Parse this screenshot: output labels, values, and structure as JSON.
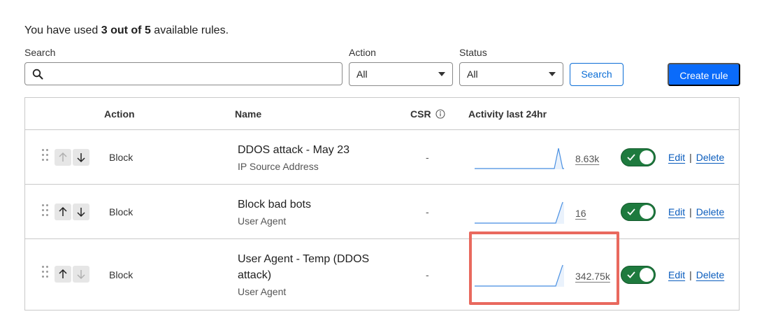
{
  "usage": {
    "prefix": "You have used ",
    "bold": "3 out of 5",
    "suffix": " available rules."
  },
  "filters": {
    "search_label": "Search",
    "search_value": "",
    "action_label": "Action",
    "action_value": "All",
    "status_label": "Status",
    "status_value": "All",
    "search_button": "Search",
    "create_button": "Create rule"
  },
  "table": {
    "headers": {
      "action": "Action",
      "name": "Name",
      "csr": "CSR",
      "activity": "Activity last 24hr"
    },
    "rows": [
      {
        "action": "Block",
        "name": "DDOS attack - May 23",
        "subtitle": "IP Source Address",
        "csr": "-",
        "count": "8.63k",
        "enabled": true,
        "edit": "Edit",
        "delete": "Delete",
        "sep": "|"
      },
      {
        "action": "Block",
        "name": "Block bad bots",
        "subtitle": "User Agent",
        "csr": "-",
        "count": "16",
        "enabled": true,
        "edit": "Edit",
        "delete": "Delete",
        "sep": "|"
      },
      {
        "action": "Block",
        "name": "User Agent - Temp (DDOS attack)",
        "subtitle": "User Agent",
        "csr": "-",
        "count": "342.75k",
        "enabled": true,
        "edit": "Edit",
        "delete": "Delete",
        "sep": "|"
      }
    ]
  },
  "colors": {
    "primary": "#0a6bfa",
    "link": "#0a5cbd",
    "toggle_on": "#1e7a3e",
    "sparkline": "#4a90e2",
    "highlight": "#e9695e"
  },
  "icons": {
    "search": "search-icon",
    "info": "info-icon",
    "drag": "drag-handle-icon",
    "up": "arrow-up-icon",
    "down": "arrow-down-icon",
    "check": "check-icon",
    "caret": "caret-down-icon"
  }
}
